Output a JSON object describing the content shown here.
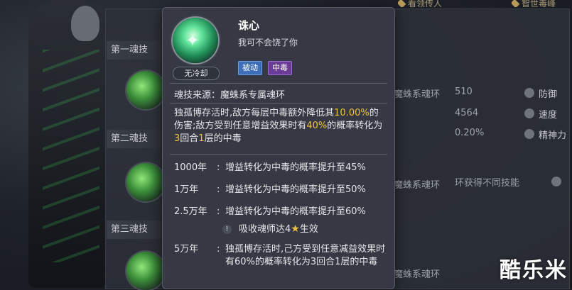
{
  "top_tabs": [
    "看领传人",
    "智世毒峰"
  ],
  "background": {
    "soul_tabs": [
      "第一魂技",
      "第二魂技",
      "第三魂技"
    ],
    "ring_labels": [
      "魔蛛系魂环",
      "魔蛛系魂环",
      "魔蛛系魂环"
    ],
    "stats": [
      {
        "icon": "shield-icon",
        "label": "防御",
        "value": "510"
      },
      {
        "icon": "speed-icon",
        "label": "速度",
        "value": "4564"
      },
      {
        "icon": "spirit-icon",
        "label": "精神力",
        "value": "0.20%"
      }
    ],
    "hint": "环获得不同技能"
  },
  "watermark": "酷乐米",
  "popup": {
    "name": "诛心",
    "quote": "我可不会饶了你",
    "cooldown": "无冷却",
    "tags": [
      "被动",
      "中毒"
    ],
    "source": "魂技来源：魔蛛系专属魂环",
    "desc": {
      "p1": "独孤博存活时,敌方每层中毒额外降低其",
      "v1": "10.00%",
      "p2": "的伤害;敌方受到任意增益效果时有",
      "v2": "40%",
      "p3": "的概率转化为",
      "v3": "3",
      "p4": "回合",
      "v4": "1",
      "p5": "层的中毒"
    },
    "levels": [
      {
        "label": "1000年",
        "text": "增益转化为中毒的概率提升至45%"
      },
      {
        "label": "1万年",
        "text": "增益转化为中毒的概率提升至50%"
      },
      {
        "label": "2.5万年",
        "text": "增益转化为中毒的概率提升至60%"
      }
    ],
    "requirement": {
      "pre": "吸收魂师达4",
      "post": "生效"
    },
    "level_5w": {
      "label": "5万年",
      "text": "独孤博存活时,己方受到任意减益效果时有60%的概率转化为3回合1层的中毒"
    }
  }
}
